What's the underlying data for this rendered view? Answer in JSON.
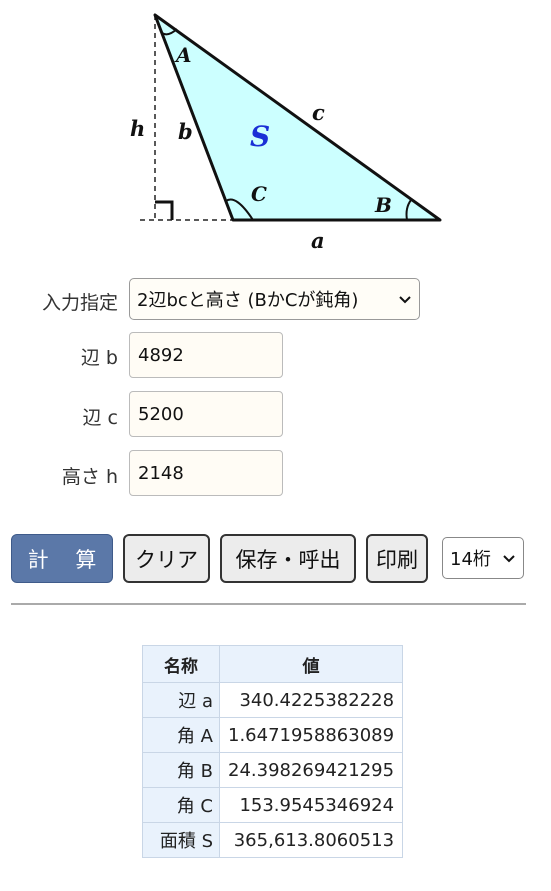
{
  "diagram": {
    "vertex_A": "A",
    "vertex_B": "B",
    "vertex_C": "C",
    "side_a": "a",
    "side_b": "b",
    "side_c": "c",
    "height": "h",
    "area": "S",
    "fill_color": "#ccffff",
    "area_label_color": "#1a2fd6"
  },
  "form": {
    "mode_label": "入力指定",
    "mode_value": "2辺bcと高さ (BかCが鈍角)",
    "fields": [
      {
        "label": "辺 b",
        "value": "4892"
      },
      {
        "label": "辺 c",
        "value": "5200"
      },
      {
        "label": "高さ h",
        "value": "2148"
      }
    ]
  },
  "buttons": {
    "calc": "計 算",
    "clear": "クリア",
    "save": "保存・呼出",
    "print": "印刷",
    "digits_value": "14桁"
  },
  "results": {
    "header_name": "名称",
    "header_value": "値",
    "rows": [
      {
        "name": "辺 a",
        "value": "340.4225382228"
      },
      {
        "name": "角 A",
        "value": "1.6471958863089"
      },
      {
        "name": "角 B",
        "value": "24.398269421295"
      },
      {
        "name": "角 C",
        "value": "153.9545346924"
      },
      {
        "name": "面積 S",
        "value": "365,613.8060513"
      }
    ]
  },
  "colors": {
    "primary_button": "#5b78a8",
    "table_header_bg": "#e9f2fc"
  }
}
